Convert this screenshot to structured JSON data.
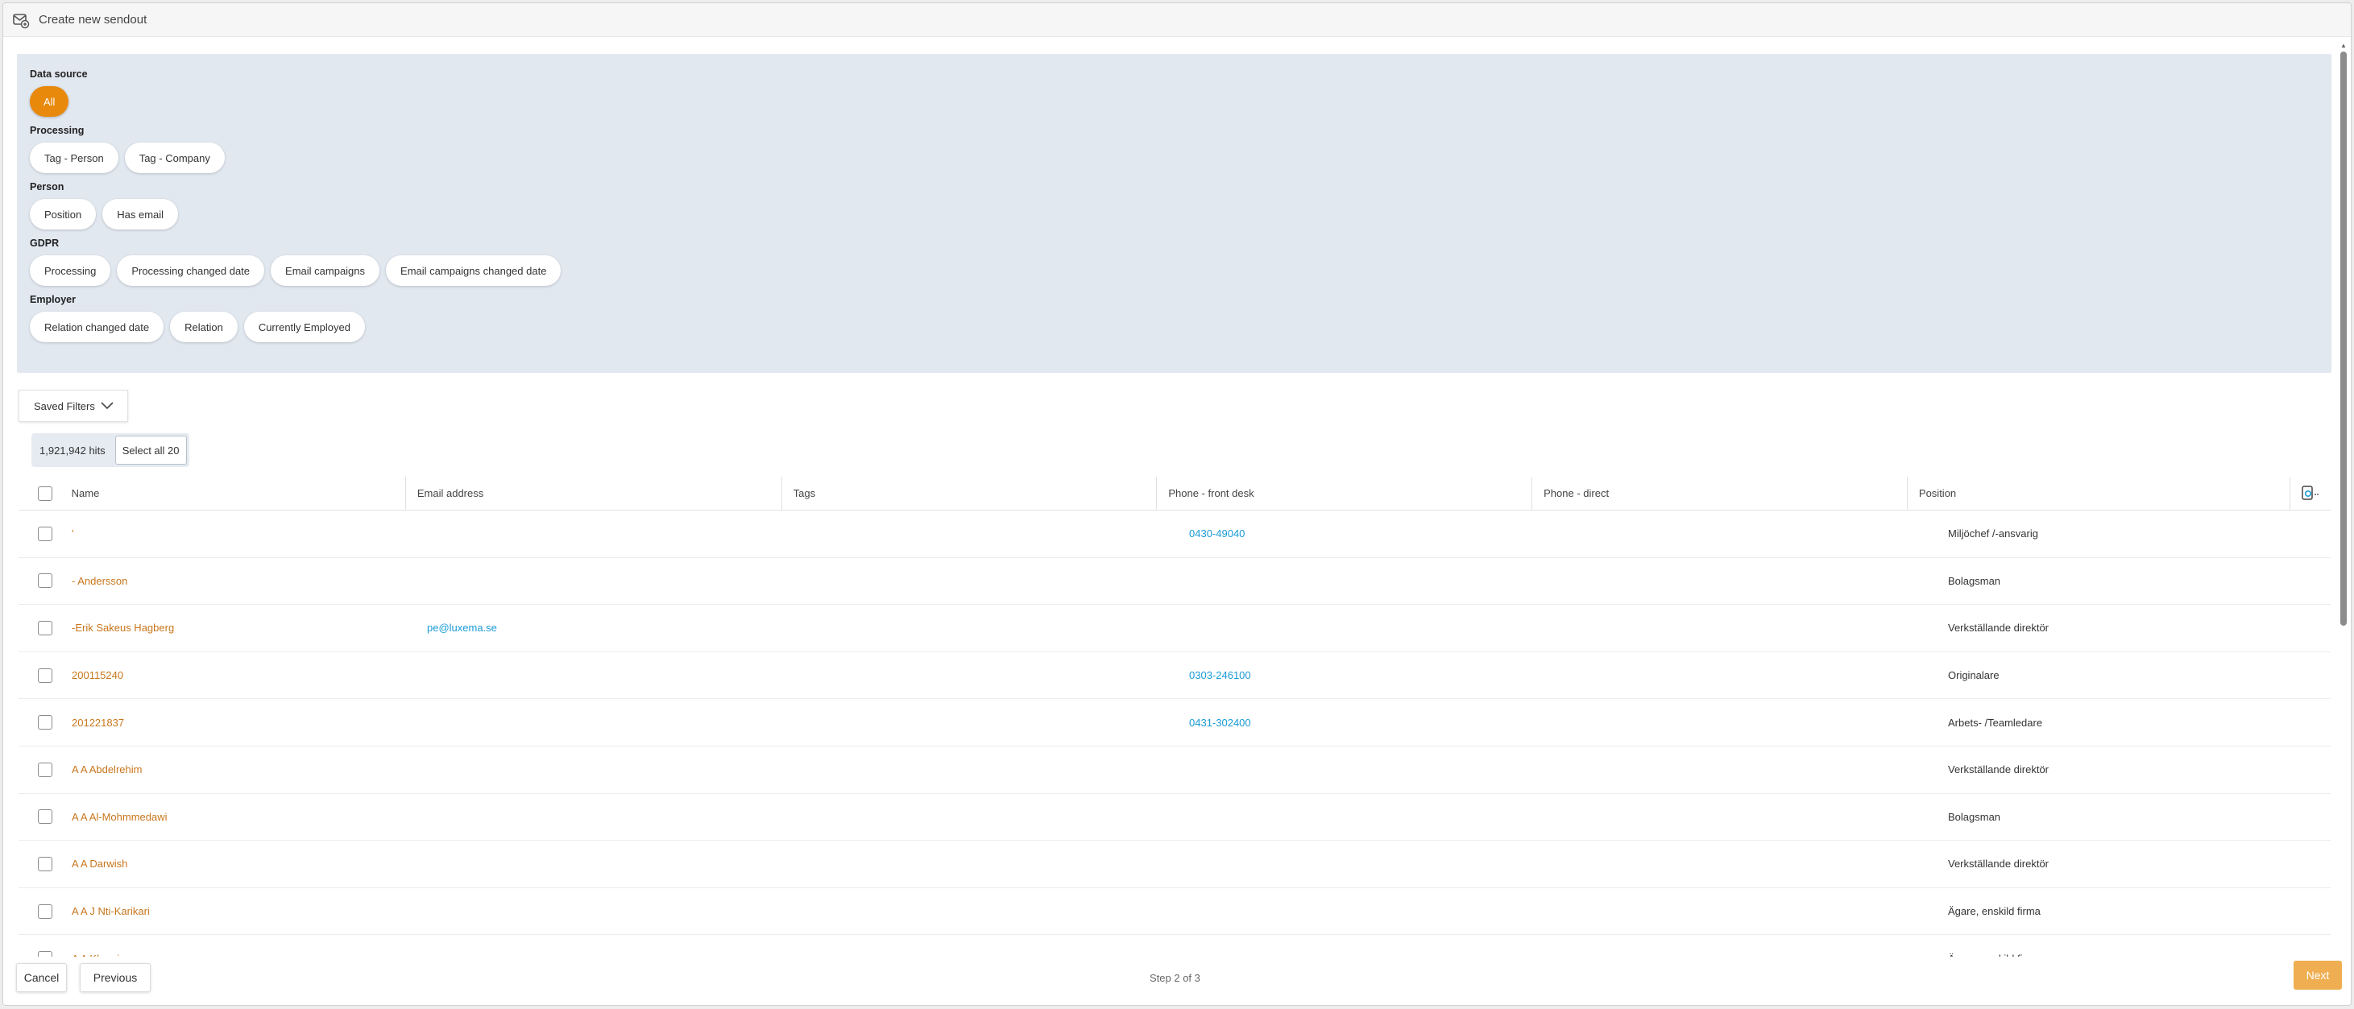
{
  "window": {
    "title": "Create new sendout"
  },
  "filters": {
    "groups": [
      {
        "title": "Data source",
        "chips": [
          "All"
        ]
      },
      {
        "title": "Processing",
        "chips": [
          "Tag - Person",
          "Tag - Company"
        ]
      },
      {
        "title": "Person",
        "chips": [
          "Position",
          "Has email"
        ]
      },
      {
        "title": "GDPR",
        "chips": [
          "Processing",
          "Processing changed date",
          "Email campaigns",
          "Email campaigns changed date"
        ]
      },
      {
        "title": "Employer",
        "chips": [
          "Relation changed date",
          "Relation",
          "Currently Employed"
        ]
      }
    ],
    "active_color": "#e8890c",
    "panel_color": "#e2e8f0"
  },
  "saved_filters": {
    "label": "Saved Filters"
  },
  "hits": {
    "count_label": "1,921,942 hits",
    "select_all_label": "Select all 20"
  },
  "table": {
    "columns": [
      "Name",
      "Email address",
      "Tags",
      "Phone - front desk",
      "Phone - direct",
      "Position"
    ],
    "rows": [
      {
        "name": "'",
        "email": "",
        "tags": "",
        "phone_front": "0430-49040",
        "phone_direct": "",
        "position": "Miljöchef /-ansvarig"
      },
      {
        "name": "- Andersson",
        "email": "",
        "tags": "",
        "phone_front": "",
        "phone_direct": "",
        "position": "Bolagsman"
      },
      {
        "name": "-Erik Sakeus Hagberg",
        "email": "pe@luxema.se",
        "tags": "",
        "phone_front": "",
        "phone_direct": "",
        "position": "Verkställande direktör"
      },
      {
        "name": "200115240",
        "email": "",
        "tags": "",
        "phone_front": "0303-246100",
        "phone_direct": "",
        "position": "Originalare"
      },
      {
        "name": "201221837",
        "email": "",
        "tags": "",
        "phone_front": "0431-302400",
        "phone_direct": "",
        "position": "Arbets- /Teamledare"
      },
      {
        "name": "A A Abdelrehim",
        "email": "",
        "tags": "",
        "phone_front": "",
        "phone_direct": "",
        "position": "Verkställande direktör"
      },
      {
        "name": "A A Al-Mohmmedawi",
        "email": "",
        "tags": "",
        "phone_front": "",
        "phone_direct": "",
        "position": "Bolagsman"
      },
      {
        "name": "A A Darwish",
        "email": "",
        "tags": "",
        "phone_front": "",
        "phone_direct": "",
        "position": "Verkställande direktör"
      },
      {
        "name": "A A J Nti-Karikari",
        "email": "",
        "tags": "",
        "phone_front": "",
        "phone_direct": "",
        "position": "Ägare, enskild firma"
      },
      {
        "name": "A A Khamis",
        "email": "",
        "tags": "",
        "phone_front": "",
        "phone_direct": "",
        "position": "Ägare, enskild firma"
      }
    ],
    "name_color": "#c8761c",
    "link_color": "#1a9bd6"
  },
  "footer": {
    "cancel_label": "Cancel",
    "previous_label": "Previous",
    "step_label": "Step 2 of 3",
    "next_label": "Next",
    "next_color": "#f0ae52"
  }
}
